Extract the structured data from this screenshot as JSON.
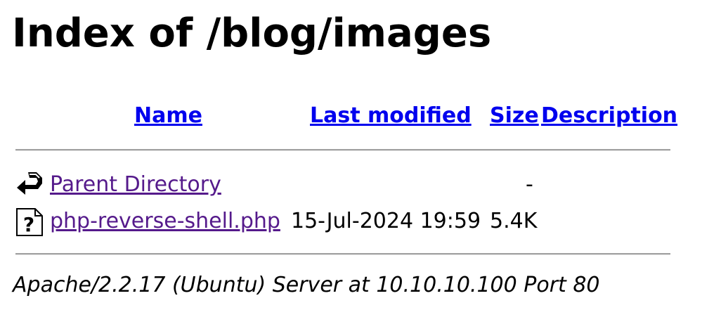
{
  "page": {
    "title": "Index of /blog/images"
  },
  "table": {
    "headers": {
      "name": "Name",
      "last_modified": "Last modified",
      "size": "Size",
      "description": "Description"
    },
    "rows": [
      {
        "icon": "back-arrow-icon",
        "name": "Parent Directory",
        "last_modified": "",
        "size": "-",
        "description": ""
      },
      {
        "icon": "unknown-file-icon",
        "name": "php-reverse-shell.php",
        "last_modified": "15-Jul-2024 19:59",
        "size": "5.4K",
        "description": ""
      }
    ]
  },
  "footer": {
    "server_signature": "Apache/2.2.17 (Ubuntu) Server at 10.10.10.100 Port 80"
  },
  "colors": {
    "link": "#0000ee",
    "visited_link": "#551a8b",
    "rule": "#a0a0a0"
  }
}
